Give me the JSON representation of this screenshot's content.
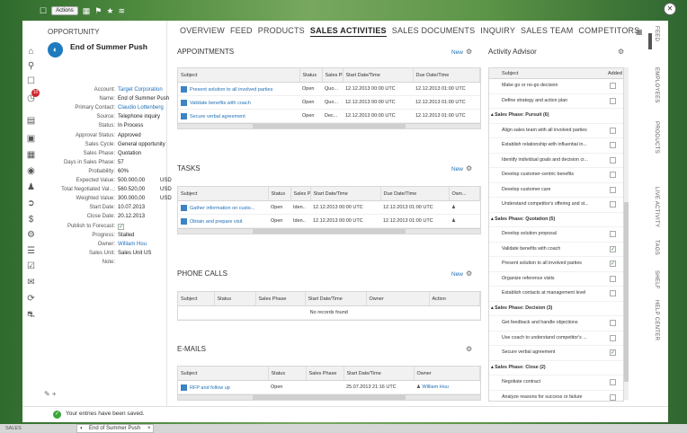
{
  "toolbar": {
    "actions_label": "Actions"
  },
  "header": {
    "section_label": "OPPORTUNITY",
    "name": "End of Summer Push",
    "fields": [
      {
        "label": "Account:",
        "value": "Target Corporation",
        "link": true
      },
      {
        "label": "Name:",
        "value": "End of Summer Push"
      },
      {
        "label": "Primary Contact:",
        "value": "Claudio Lottenberg",
        "link": true
      },
      {
        "label": "Source:",
        "value": "Telephone inquiry"
      },
      {
        "label": "Status:",
        "value": "In Process"
      },
      {
        "label": "Approval Status:",
        "value": "Approved"
      },
      {
        "label": "Sales Cycle:",
        "value": "General opportunity"
      },
      {
        "label": "Sales Phase:",
        "value": "Quotation"
      },
      {
        "label": "Days in Sales Phase:",
        "value": "57"
      },
      {
        "label": "Probability:",
        "value": "60%"
      },
      {
        "label": "Expected Value:",
        "value": "500.000,00",
        "currency": "USD"
      },
      {
        "label": "Total Negotiated Val...:",
        "value": "560.520,00",
        "currency": "USD"
      },
      {
        "label": "Weighted Value:",
        "value": "300.000,00",
        "currency": "USD"
      },
      {
        "label": "Start Date:",
        "value": "10.07.2013"
      },
      {
        "label": "Close Date:",
        "value": "20.12.2013"
      },
      {
        "label": "Publish to Forecast:",
        "value": "",
        "checkbox": true
      },
      {
        "label": "Progress:",
        "value": "Stalled"
      },
      {
        "label": "Owner:",
        "value": "William Hou",
        "link": true
      },
      {
        "label": "Sales Unit:",
        "value": "Sales Unit US"
      },
      {
        "label": "Note:",
        "value": ""
      }
    ]
  },
  "tabs": [
    "OVERVIEW",
    "FEED",
    "PRODUCTS",
    "SALES ACTIVITIES",
    "SALES DOCUMENTS",
    "INQUIRY",
    "SALES TEAM",
    "COMPETITORS"
  ],
  "active_tab_index": 3,
  "appointments": {
    "title": "APPOINTMENTS",
    "new_label": "New",
    "columns": [
      "Subject",
      "Status",
      "Sales Phase",
      "Start Date/Time",
      "Due Date/Time"
    ],
    "rows": [
      [
        "Present solution to all involved parties",
        "Open",
        "Quo...",
        "12.12.2013 00:00 UTC",
        "12.12.2013 01:00 UTC"
      ],
      [
        "Validate benefits with coach",
        "Open",
        "Quo...",
        "12.12.2013 00:00 UTC",
        "12.12.2013 01:00 UTC"
      ],
      [
        "Secure verbal agreement",
        "Open",
        "Dec...",
        "12.12.2013 00:00 UTC",
        "12.12.2013 01:00 UTC"
      ]
    ]
  },
  "tasks": {
    "title": "TASKS",
    "new_label": "New",
    "columns": [
      "Subject",
      "Status",
      "Sales Phase",
      "Start Date/Time",
      "Due Date/Time",
      "Own..."
    ],
    "rows": [
      [
        "Gather information on custo...",
        "Open",
        "Iden..",
        "12.12.2013 00:00 UTC",
        "12.12.2013 01:00 UTC",
        ""
      ],
      [
        "Obtain and prepare visit",
        "Open",
        "Iden..",
        "12.12.2013 00:00 UTC",
        "12.12.2013 01:00 UTC",
        ""
      ]
    ]
  },
  "phone_calls": {
    "title": "PHONE CALLS",
    "new_label": "New",
    "columns": [
      "Subject",
      "Status",
      "Sales Phase",
      "Start Date/Time",
      "Owner",
      "Action"
    ],
    "empty_text": "No records found"
  },
  "emails": {
    "title": "E-MAILS",
    "columns": [
      "Subject",
      "Status",
      "Sales Phase",
      "Start Date/Time",
      "Owner"
    ],
    "rows": [
      [
        "RFP and follow up",
        "Open",
        "",
        "25.07.2013 21:16 UTC",
        "William Hou"
      ]
    ]
  },
  "advisor": {
    "title": "Activity Advisor",
    "col_subject": "Subject",
    "col_added": "Added",
    "rows": [
      {
        "text": "Make go or no-go decision",
        "checked": false
      },
      {
        "text": "Define strategy and action plan",
        "checked": false
      },
      {
        "text": "Sales Phase: Pursuit (6)",
        "phase": true
      },
      {
        "text": "Align sales team with all involved parties",
        "checked": false
      },
      {
        "text": "Establish relationship with influential in...",
        "checked": false
      },
      {
        "text": "Identify individual goals and decision cr...",
        "checked": false
      },
      {
        "text": "Develop customer-centric benefits",
        "checked": false
      },
      {
        "text": "Develop customer care",
        "checked": false
      },
      {
        "text": "Understand competitor's offering and st...",
        "checked": false
      },
      {
        "text": "Sales Phase: Quotation (5)",
        "phase": true
      },
      {
        "text": "Develop solution proposal",
        "checked": false
      },
      {
        "text": "Validate benefits with coach",
        "checked": true
      },
      {
        "text": "Present solution to all involved parties",
        "checked": true
      },
      {
        "text": "Organize reference visits",
        "checked": false
      },
      {
        "text": "Establish contacts at management level",
        "checked": false
      },
      {
        "text": "Sales Phase: Decision (3)",
        "phase": true
      },
      {
        "text": "Get feedback and handle objections",
        "checked": false
      },
      {
        "text": "Use coach to understand competitor's ...",
        "checked": false
      },
      {
        "text": "Secure verbal agreement",
        "checked": true
      },
      {
        "text": "Sales Phase: Close (2)",
        "phase": true
      },
      {
        "text": "Negotiate contract",
        "checked": false
      },
      {
        "text": "Analyze reasons for success or failure",
        "checked": false
      }
    ]
  },
  "side_tabs": [
    "FEED",
    "EMPLOYEES",
    "PRODUCTS",
    "LIVE ACTIVITY",
    "TAGS",
    "SHELF",
    "HELP CENTER"
  ],
  "notification_count": "10",
  "status_message": "Your entries have been saved.",
  "bottom": {
    "sales_label": "SALES",
    "open_tab_label": "End of Summer Push"
  },
  "colors": {
    "link": "#1f6fb6",
    "badge": "#d0262b",
    "success": "#3aa63a"
  }
}
